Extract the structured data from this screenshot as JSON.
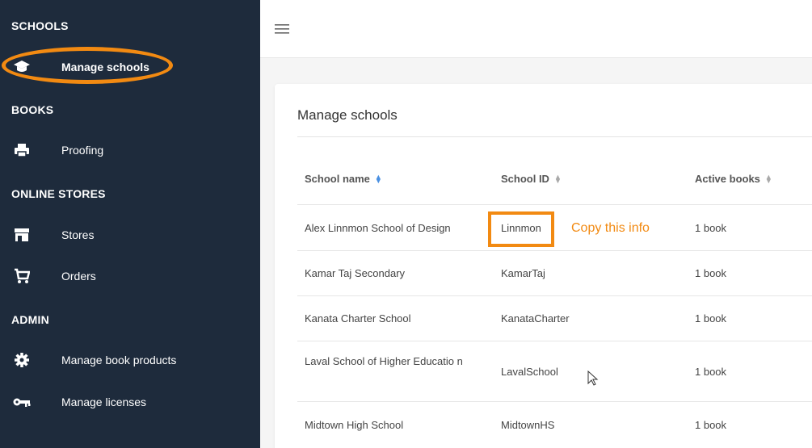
{
  "sidebar": {
    "sections": [
      {
        "label": "SCHOOLS"
      },
      {
        "label": "BOOKS"
      },
      {
        "label": "ONLINE STORES"
      },
      {
        "label": "ADMIN"
      }
    ],
    "items": [
      {
        "label": "Manage schools",
        "icon": "graduation-cap-icon"
      },
      {
        "label": "Proofing",
        "icon": "printer-icon"
      },
      {
        "label": "Stores",
        "icon": "store-icon"
      },
      {
        "label": "Orders",
        "icon": "cart-icon"
      },
      {
        "label": "Manage book products",
        "icon": "gear-icon"
      },
      {
        "label": "Manage licenses",
        "icon": "key-icon"
      }
    ]
  },
  "main": {
    "title": "Manage schools",
    "columns": [
      "School name",
      "School ID",
      "Active books"
    ],
    "rows": [
      {
        "name": "Alex Linnmon School of Design",
        "id": "Linnmon",
        "books": "1 book"
      },
      {
        "name": "Kamar Taj Secondary",
        "id": "KamarTaj",
        "books": "1 book"
      },
      {
        "name": "Kanata Charter School",
        "id": "KanataCharter",
        "books": "1 book"
      },
      {
        "name": "Laval School of Higher Educatio n",
        "id": "LavalSchool",
        "books": "1 book"
      },
      {
        "name": "Midtown High School",
        "id": "MidtownHS",
        "books": "1 book"
      }
    ]
  },
  "annotation": {
    "note": "Copy this info",
    "color": "#f28a12"
  },
  "colors": {
    "sidebar_bg": "#1e2b3c",
    "accent": "#f28a12",
    "sort_active": "#4a90e2"
  }
}
